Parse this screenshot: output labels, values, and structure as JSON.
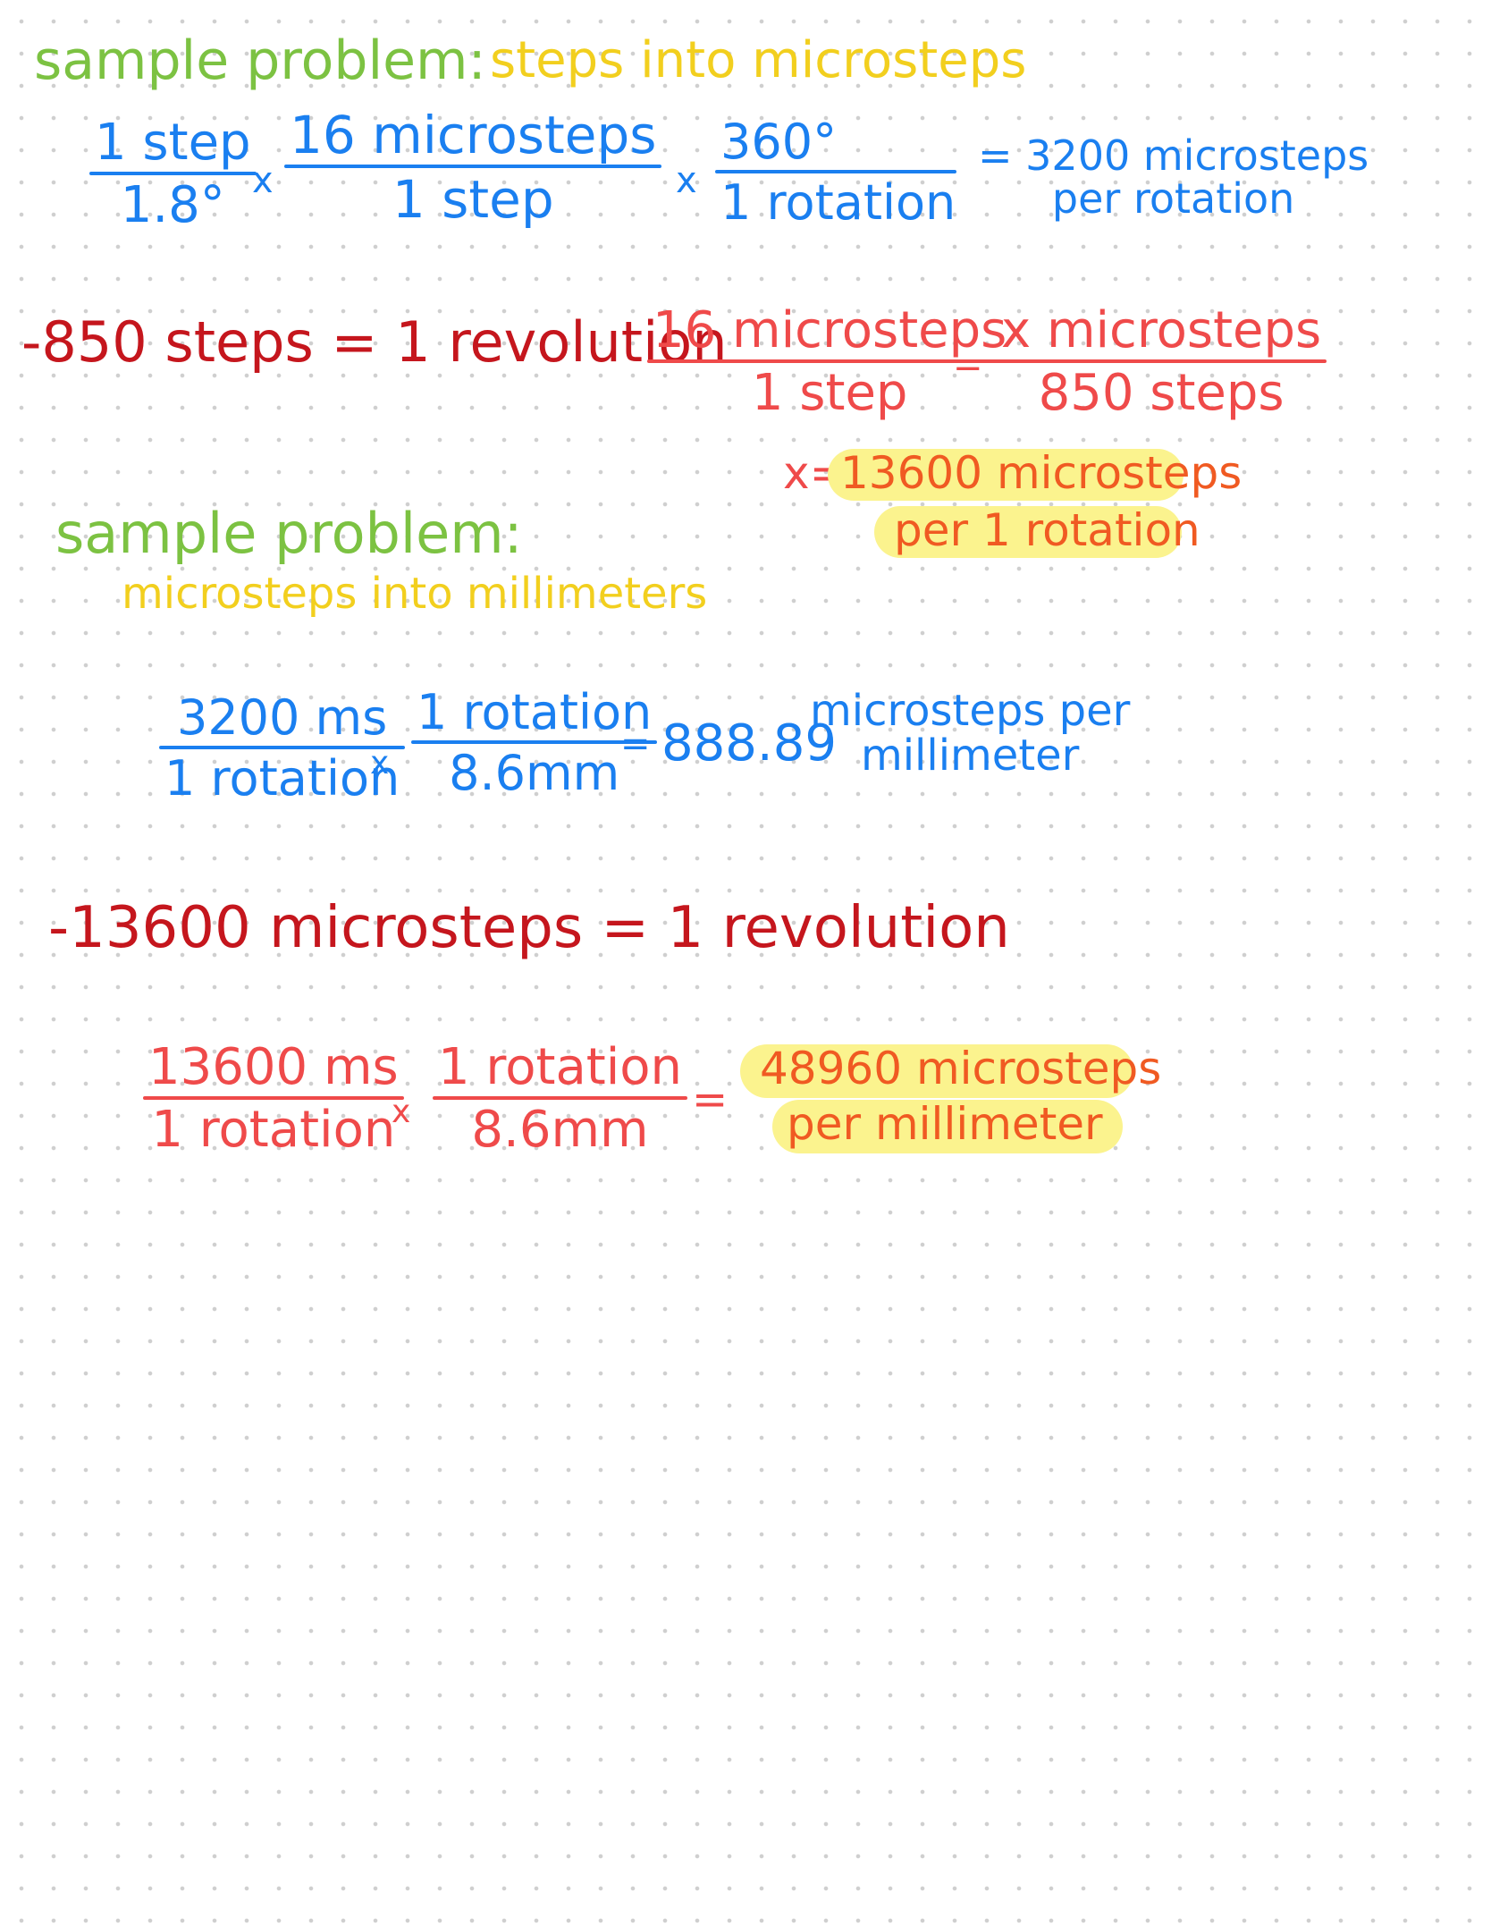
{
  "colors": {
    "green": "#7cc242",
    "yellow": "#f2cf1e",
    "blue": "#1a7ff0",
    "dark_red": "#c5161d",
    "red": "#ef4a4a",
    "orange": "#f05a22",
    "highlight": "#fbf38e"
  },
  "section1": {
    "heading": "sample problem:",
    "subheading": "steps into microsteps",
    "frac1": {
      "num": "1 step",
      "den": "1.8°"
    },
    "op1": "x",
    "frac2": {
      "num": "16 microsteps",
      "den": "1 step"
    },
    "op2": "x",
    "frac3": {
      "num": "360°",
      "den": "1 rotation"
    },
    "result_line1": "= 3200 microsteps",
    "result_line2": "per rotation"
  },
  "section2": {
    "given": "-850 steps = 1 revolution",
    "frac1": {
      "num": "16 microsteps",
      "den": "1 step"
    },
    "equals": "=",
    "frac2": {
      "num": "x microsteps",
      "den": "850 steps"
    },
    "answer_prefix": "x=",
    "answer_line1": "13600 microsteps",
    "answer_line2": "per 1 rotation"
  },
  "section3": {
    "heading": "sample problem:",
    "subheading": "microsteps into millimeters",
    "frac1": {
      "num": "3200 ms",
      "den": "1 rotation"
    },
    "op1": "x",
    "frac2": {
      "num": "1 rotation",
      "den": "8.6mm"
    },
    "equals": "=",
    "value": "888.89",
    "unit_line1": "microsteps per",
    "unit_line2": "millimeter"
  },
  "section4": {
    "given": "-13600 microsteps = 1 revolution",
    "frac1": {
      "num": "13600 ms",
      "den": "1 rotation"
    },
    "op1": "x",
    "frac2": {
      "num": "1 rotation",
      "den": "8.6mm"
    },
    "equals": "=",
    "answer_line1": "48960 microsteps",
    "answer_line2": "per millimeter"
  }
}
